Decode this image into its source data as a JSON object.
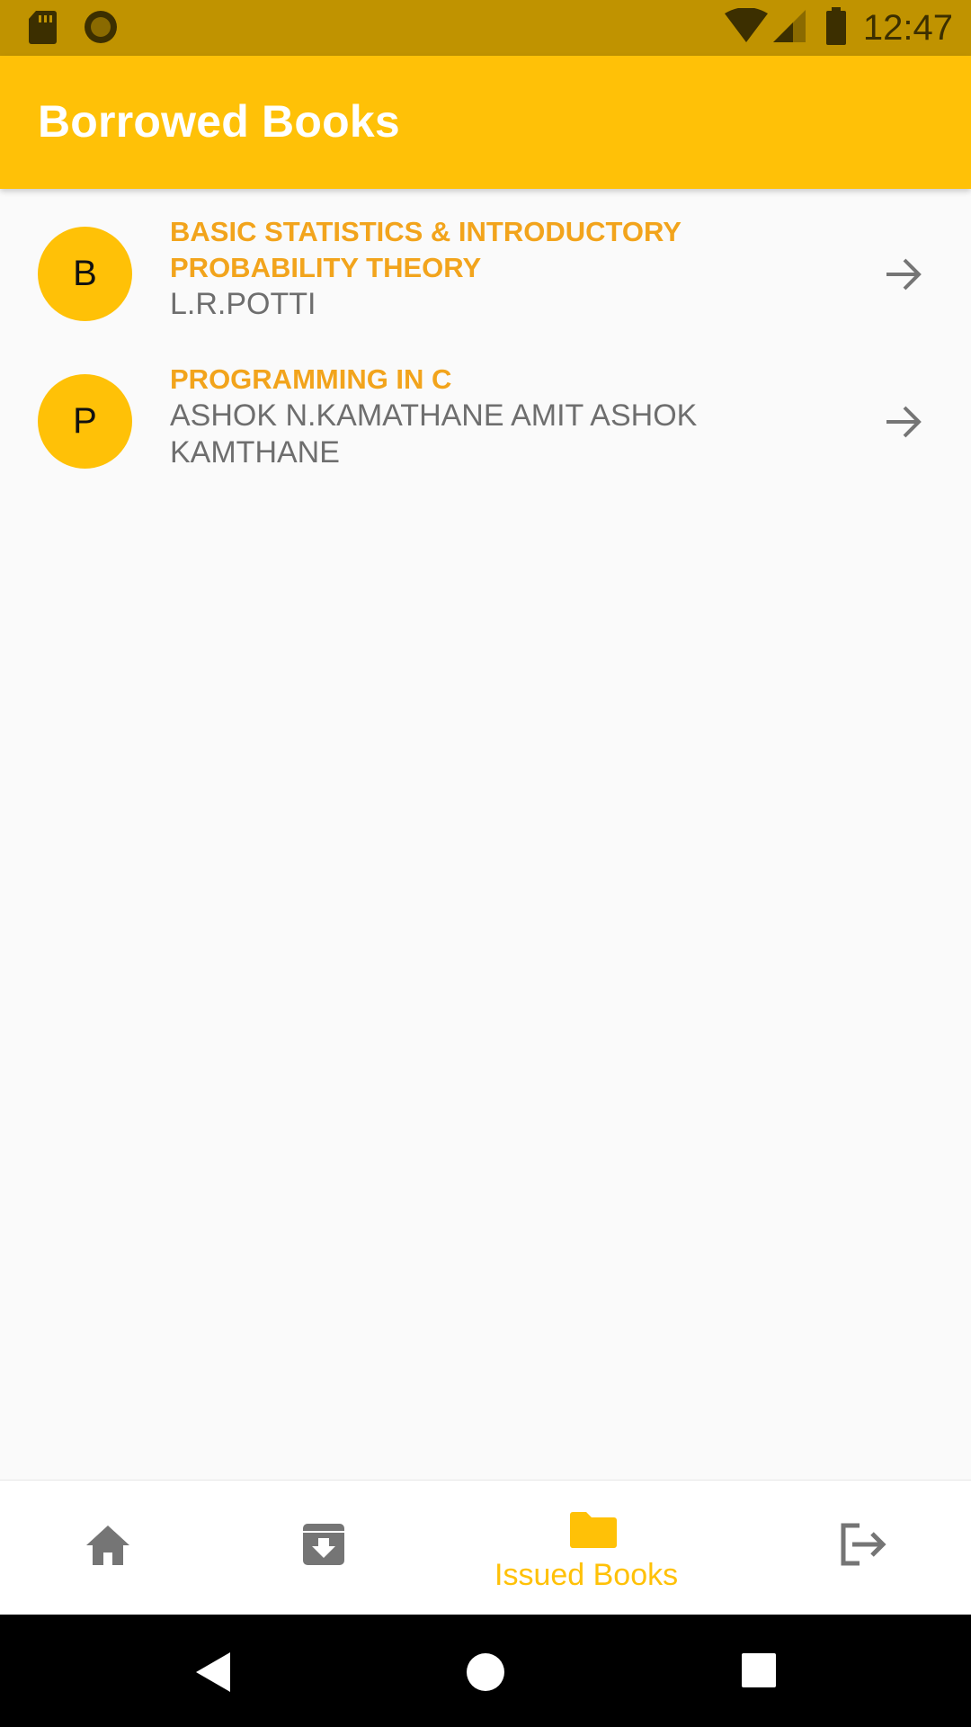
{
  "status_bar": {
    "time": "12:47",
    "icons": [
      "sd-card-icon",
      "record-icon",
      "wifi-icon",
      "cell-signal-icon",
      "battery-icon"
    ]
  },
  "app_bar": {
    "title": "Borrowed Books"
  },
  "books": [
    {
      "initial": "B",
      "title": "BASIC STATISTICS & INTRODUCTORY PROBABILITY THEORY",
      "author": "L.R.POTTI"
    },
    {
      "initial": "P",
      "title": "PROGRAMMING IN C",
      "author": "ASHOK N.KAMATHANE AMIT ASHOK KAMTHANE"
    }
  ],
  "bottom_nav": {
    "items": [
      {
        "icon": "home-icon",
        "label": ""
      },
      {
        "icon": "archive-download-icon",
        "label": ""
      },
      {
        "icon": "folder-icon",
        "label": "Issued Books",
        "selected": true
      },
      {
        "icon": "logout-icon",
        "label": ""
      }
    ]
  },
  "system_nav": {
    "icons": [
      "back-icon",
      "home-circle-icon",
      "recents-icon"
    ]
  },
  "colors": {
    "accent": "#ffc107",
    "status_bar": "#c09300",
    "title_text": "#f2a41c",
    "author_text": "#6e6e6e",
    "icon_gray": "#757575"
  }
}
